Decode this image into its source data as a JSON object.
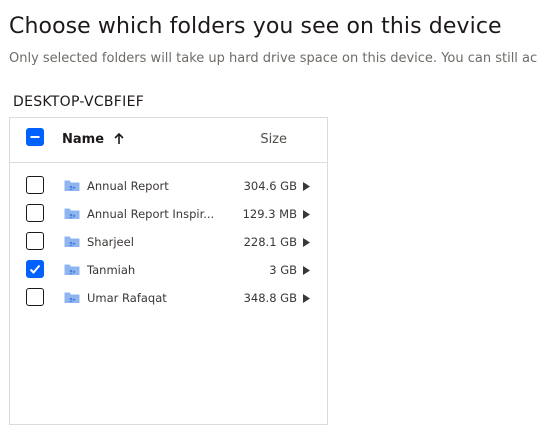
{
  "page": {
    "title": "Choose which folders you see on this device",
    "subtitle": "Only selected folders will take up hard drive space on this device. You can still ac"
  },
  "device": {
    "name": "DESKTOP-VCBFIEF"
  },
  "table": {
    "select_all_state": "indeterminate",
    "columns": {
      "name": "Name",
      "size": "Size"
    },
    "sort": {
      "column": "name",
      "direction": "ascending",
      "icon": "arrow-up-icon"
    },
    "rows": [
      {
        "name": "Annual Report",
        "size": "304.6 GB",
        "checked": false,
        "icon": "shared-folder-icon"
      },
      {
        "name": "Annual Report Inspir...",
        "size": "129.3 MB",
        "checked": false,
        "icon": "shared-folder-icon"
      },
      {
        "name": "Sharjeel",
        "size": "228.1 GB",
        "checked": false,
        "icon": "shared-folder-icon"
      },
      {
        "name": "Tanmiah",
        "size": "3 GB",
        "checked": true,
        "icon": "shared-folder-icon"
      },
      {
        "name": "Umar Rafaqat",
        "size": "348.8 GB",
        "checked": false,
        "icon": "shared-folder-icon"
      }
    ]
  },
  "colors": {
    "accent": "#0061fe",
    "folder": "#8fb4f2",
    "border": "#dedcda",
    "muted_text": "#6f6b67"
  }
}
